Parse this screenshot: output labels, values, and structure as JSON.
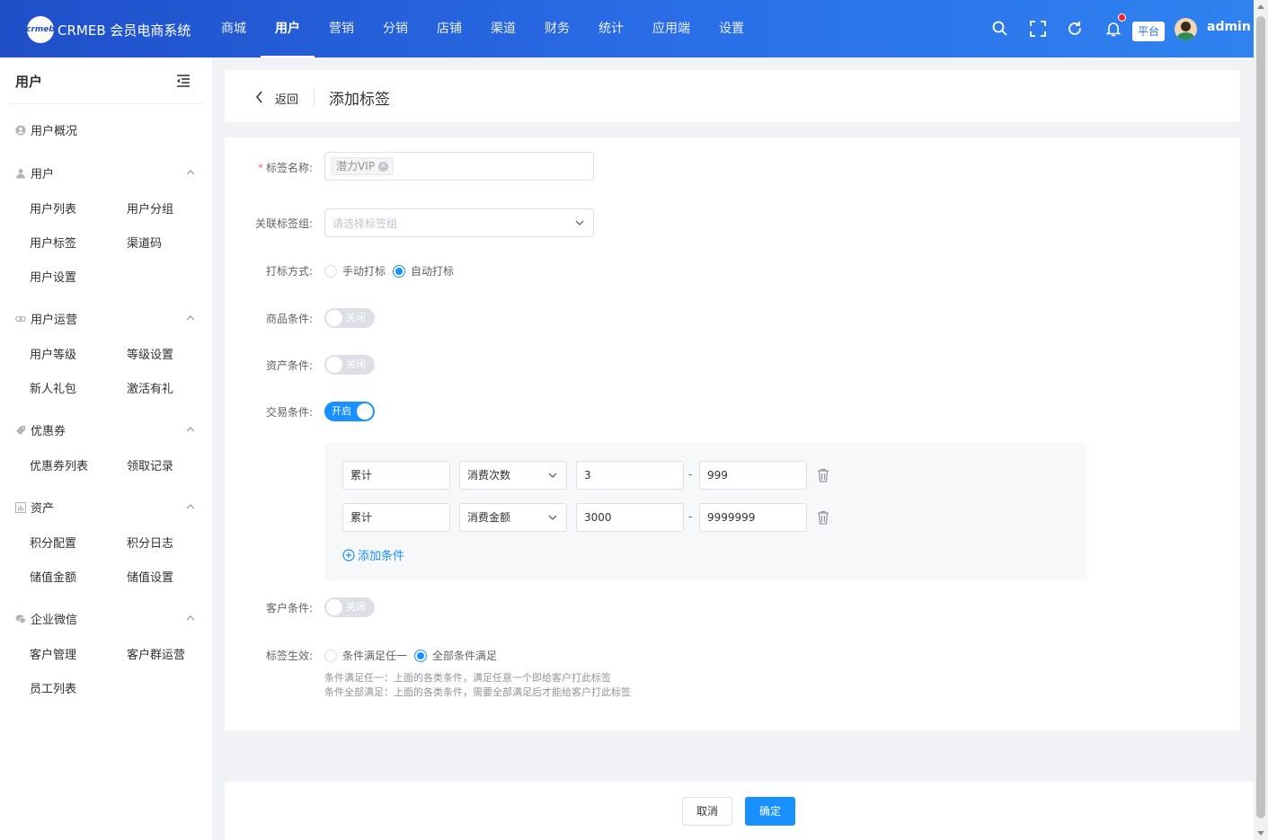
{
  "app": {
    "logo_badge": "crmeb",
    "logo_text": "CRMEB 会员电商系统"
  },
  "topnav": [
    "商城",
    "用户",
    "营销",
    "分销",
    "店铺",
    "渠道",
    "财务",
    "统计",
    "应用端",
    "设置"
  ],
  "topnav_active": "用户",
  "header": {
    "platform_label": "平台",
    "username": "admin"
  },
  "sidebar": {
    "title": "用户",
    "overview": "用户概况",
    "groups": [
      {
        "label": "用户",
        "items": [
          "用户列表",
          "用户分组",
          "用户标签",
          "渠道码",
          "用户设置"
        ]
      },
      {
        "label": "用户运营",
        "items": [
          "用户等级",
          "等级设置",
          "新人礼包",
          "激活有礼"
        ]
      },
      {
        "label": "优惠券",
        "items": [
          "优惠券列表",
          "领取记录"
        ]
      },
      {
        "label": "资产",
        "items": [
          "积分配置",
          "积分日志",
          "储值金额",
          "储值设置"
        ]
      },
      {
        "label": "企业微信",
        "items": [
          "客户管理",
          "客户群运营",
          "员工列表"
        ]
      }
    ]
  },
  "page": {
    "back_label": "返回",
    "title": "添加标签"
  },
  "form": {
    "tag_name": {
      "label": "标签名称:",
      "tag_value": "潜力VIP"
    },
    "tag_group": {
      "label": "关联标签组:",
      "placeholder": "请选择标签组"
    },
    "tag_mode": {
      "label": "打标方式:",
      "options": [
        "手动打标",
        "自动打标"
      ],
      "selected": "自动打标"
    },
    "goods_condition": {
      "label": "商品条件:",
      "state": "关闭"
    },
    "asset_condition": {
      "label": "资产条件:",
      "state": "关闭"
    },
    "trade_condition": {
      "label": "交易条件:",
      "state": "开启"
    },
    "trade_rows": [
      {
        "scope": "累计",
        "metric": "消费次数",
        "min": "3",
        "max": "999"
      },
      {
        "scope": "累计",
        "metric": "消费金额",
        "min": "3000",
        "max": "9999999"
      }
    ],
    "range_separator": "-",
    "add_condition_label": "添加条件",
    "customer_condition": {
      "label": "客户条件:",
      "state": "关闭"
    },
    "effect": {
      "label": "标签生效:",
      "options": [
        "条件满足任一",
        "全部条件满足"
      ],
      "selected": "全部条件满足"
    },
    "hints": [
      "条件满足任一：上面的各类条件，满足任意一个即给客户打此标签",
      "条件全部满足：上面的各类条件，需要全部满足后才能给客户打此标签"
    ]
  },
  "footer": {
    "cancel_label": "取消",
    "confirm_label": "确定"
  },
  "colors": {
    "primary": "#1890ff",
    "header_start": "#1f4fc9",
    "header_end": "#2f82f0",
    "danger_dot": "#f5222d"
  }
}
